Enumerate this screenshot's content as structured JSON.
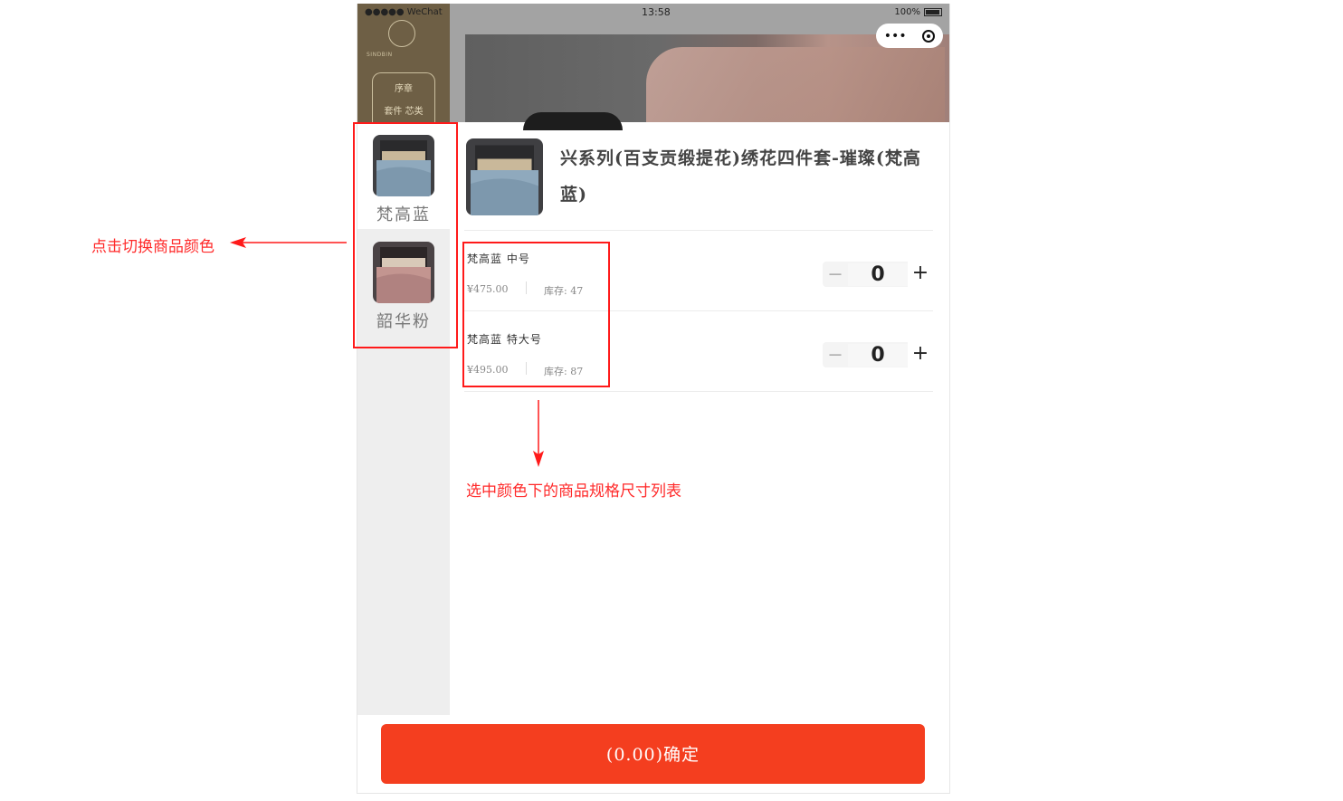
{
  "status_bar": {
    "carrier": "●●●●● WeChat",
    "time": "13:58",
    "battery": "100%"
  },
  "capsule": {
    "more_icon": "•••",
    "close_icon": "target-icon"
  },
  "brand": {
    "name": "SINDBIN",
    "box_line1": "序章",
    "box_line2": "套件   芯类"
  },
  "colors": [
    {
      "name": "梵高蓝",
      "active": true,
      "tint": "#8fa9bd"
    },
    {
      "name": "韶华粉",
      "active": false,
      "tint": "#c39590"
    }
  ],
  "product": {
    "title": "兴系列(百支贡缎提花)绣花四件套-璀璨(梵高蓝)"
  },
  "skus": [
    {
      "name": "梵高蓝 中号",
      "price": "¥475.00",
      "stock": "库存: 47",
      "qty": "0",
      "minus": "－",
      "plus": "+"
    },
    {
      "name": "梵高蓝 特大号",
      "price": "¥495.00",
      "stock": "库存: 87",
      "qty": "0",
      "minus": "－",
      "plus": "+"
    }
  ],
  "confirm_label": "(0.00)确定",
  "annotations": {
    "left_note": "点击切换商品颜色",
    "bottom_note": "选中颜色下的商品规格尺寸列表",
    "color": "#ff2a2a"
  },
  "accent": "#f43e1f"
}
